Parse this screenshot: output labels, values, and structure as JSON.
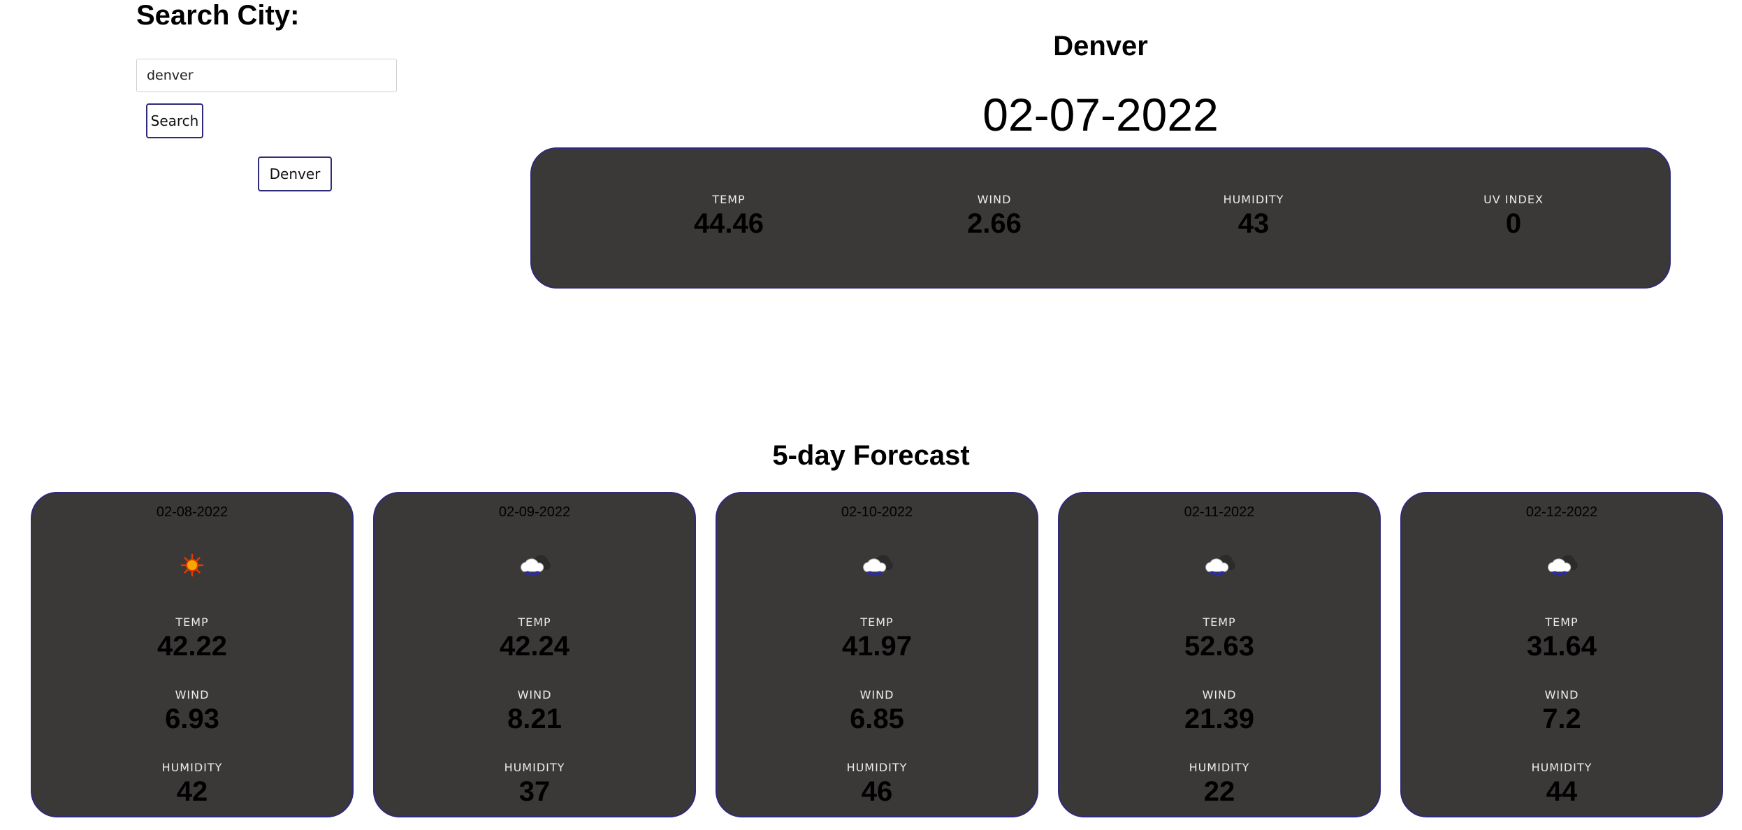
{
  "search": {
    "heading": "Search City:",
    "input_value": "denver",
    "button_label": "Search",
    "history": [
      "Denver"
    ]
  },
  "current": {
    "city": "Denver",
    "date": "02-07-2022",
    "stats": [
      {
        "label": "TEMP",
        "value": "44.46"
      },
      {
        "label": "WIND",
        "value": "2.66"
      },
      {
        "label": "HUMIDITY",
        "value": "43"
      },
      {
        "label": "UV INDEX",
        "value": "0"
      }
    ]
  },
  "forecast": {
    "heading": "5-day Forecast",
    "labels": {
      "temp": "TEMP",
      "wind": "WIND",
      "humidity": "HUMIDITY"
    },
    "days": [
      {
        "date": "02-08-2022",
        "icon": "sun-icon",
        "temp": "42.22",
        "wind": "6.93",
        "humidity": "42"
      },
      {
        "date": "02-09-2022",
        "icon": "rain-cloud-icon",
        "temp": "42.24",
        "wind": "8.21",
        "humidity": "37"
      },
      {
        "date": "02-10-2022",
        "icon": "rain-cloud-icon",
        "temp": "41.97",
        "wind": "6.85",
        "humidity": "46"
      },
      {
        "date": "02-11-2022",
        "icon": "rain-cloud-icon",
        "temp": "52.63",
        "wind": "21.39",
        "humidity": "22"
      },
      {
        "date": "02-12-2022",
        "icon": "rain-cloud-icon",
        "temp": "31.64",
        "wind": "7.2",
        "humidity": "44"
      }
    ]
  },
  "colors": {
    "card_bg": "#3b3838",
    "card_border": "#2f2a7a",
    "label_text": "#ececec",
    "value_text": "#000000"
  }
}
